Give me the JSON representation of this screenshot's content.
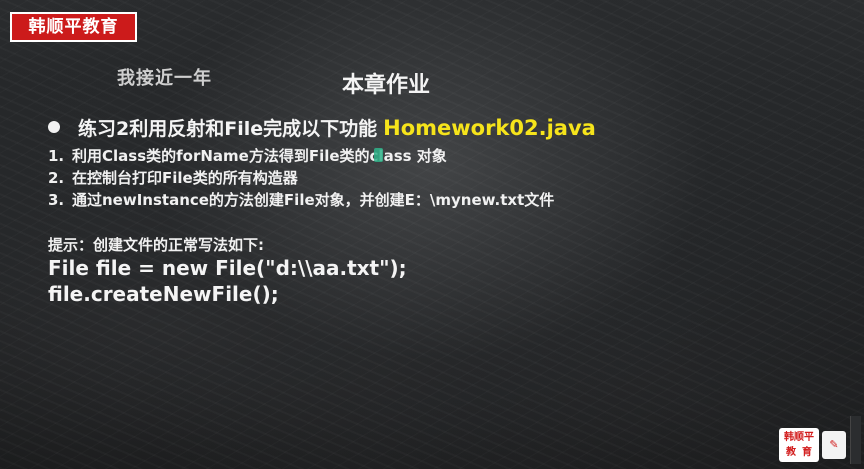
{
  "logo": {
    "text": "韩顺平教育"
  },
  "watermark": {
    "text": "我接近一年"
  },
  "chapter_title": "本章作业",
  "task": {
    "heading": "练习2利用反射和File完成以下功能",
    "filename": "Homework02.java"
  },
  "steps": [
    {
      "num": "1.",
      "text": "利用Class类的forName方法得到File类的class 对象"
    },
    {
      "num": "2.",
      "text": "在控制台打印File类的所有构造器"
    },
    {
      "num": "3.",
      "text": "通过newInstance的方法创建File对象，并创建E：\\mynew.txt文件"
    }
  ],
  "hint": "提示：创建文件的正常写法如下:",
  "code": {
    "line1": "File file = new File(\"d:\\\\aa.txt\");",
    "line2": "file.createNewFile();"
  },
  "corner_logo": {
    "top": "韩顺平",
    "bottom": "教育"
  },
  "colors": {
    "logo_bg": "#cc1b1b",
    "highlight": "#f6e41b",
    "text": "#f2f2f2"
  }
}
